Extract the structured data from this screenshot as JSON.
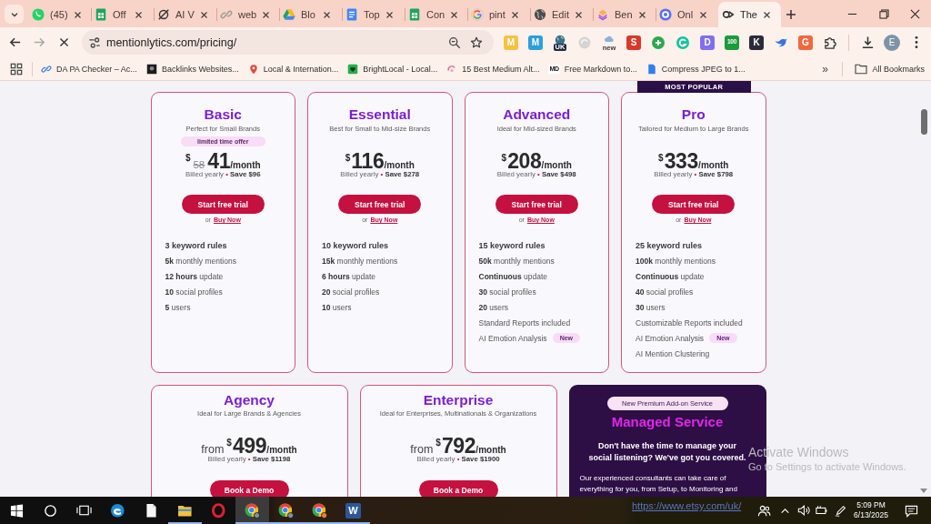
{
  "tabs": [
    {
      "title": "(45)",
      "selected": false
    },
    {
      "title": "Off",
      "selected": false
    },
    {
      "title": "AI V",
      "selected": false
    },
    {
      "title": "web",
      "selected": false
    },
    {
      "title": "Blo",
      "selected": false
    },
    {
      "title": "Top",
      "selected": false
    },
    {
      "title": "Con",
      "selected": false
    },
    {
      "title": "pint",
      "selected": false
    },
    {
      "title": "Edit",
      "selected": false
    },
    {
      "title": "Ben",
      "selected": false
    },
    {
      "title": "Onl",
      "selected": false
    },
    {
      "title": "The",
      "selected": true
    }
  ],
  "toolbar": {
    "url": "mentionlytics.com/pricing/",
    "profile_initial": "E"
  },
  "extensions": [
    {
      "kind": "letter",
      "glyph": "M",
      "color": "#f5c242"
    },
    {
      "kind": "letter",
      "glyph": "M",
      "color": "#2d9fd9"
    },
    {
      "kind": "badge",
      "glyph": "UK"
    },
    {
      "kind": "icon"
    },
    {
      "kind": "badge",
      "glyph": "new"
    },
    {
      "kind": "letter",
      "glyph": "S",
      "color": "#d8392b"
    },
    {
      "kind": "icon"
    },
    {
      "kind": "icon"
    },
    {
      "kind": "letter",
      "glyph": "D",
      "color": "#7f70f2"
    },
    {
      "kind": "letter",
      "glyph": "100",
      "color": "#1d9a3b"
    },
    {
      "kind": "letter",
      "glyph": "K",
      "color": "#2b2b38"
    },
    {
      "kind": "icon"
    },
    {
      "kind": "letter",
      "glyph": "G",
      "color": "#f0683c"
    }
  ],
  "bookmarks": {
    "items": [
      {
        "title": "DA PA Checker – Ac..."
      },
      {
        "title": "Backlinks Websites..."
      },
      {
        "title": "Local & Internation..."
      },
      {
        "title": "BrightLocal - Local..."
      },
      {
        "title": "15 Best Medium Alt..."
      },
      {
        "title": "Free Markdown to...",
        "icon_text": "MD"
      },
      {
        "title": "Compress JPEG to 1..."
      }
    ],
    "overflow": "»",
    "all_bookmarks": "All Bookmarks"
  },
  "plans": [
    {
      "name": "Basic",
      "tagline": "Perfect for Small Brands",
      "offer": "limited time offer",
      "currency": "$",
      "old_amount": "58",
      "amount": "41",
      "period": "/month",
      "billing": "Billed yearly",
      "separator": "•",
      "savings": "Save $96",
      "button": "Start free trial",
      "alt_prefix": "or",
      "alt_link": "Buy Now",
      "features": [
        {
          "kind": "headline",
          "text": "3 keyword rules"
        },
        {
          "kind": "detail",
          "text": "**5k** monthly mentions"
        },
        {
          "kind": "detail",
          "text": "**12 hours** update"
        },
        {
          "kind": "detail",
          "text": "**10** social profiles"
        },
        {
          "kind": "detail",
          "text": "**5** users"
        }
      ]
    },
    {
      "name": "Essential",
      "tagline": "Best for Small to Mid-size Brands",
      "currency": "$",
      "amount": "116",
      "period": "/month",
      "billing": "Billed yearly",
      "separator": "•",
      "savings": "Save $278",
      "button": "Start free trial",
      "alt_prefix": "or",
      "alt_link": "Buy Now",
      "features": [
        {
          "kind": "headline",
          "text": "10 keyword rules"
        },
        {
          "kind": "detail",
          "text": "**15k** monthly mentions"
        },
        {
          "kind": "detail",
          "text": "**6 hours** update"
        },
        {
          "kind": "detail",
          "text": "**20** social profiles"
        },
        {
          "kind": "detail",
          "text": "**10** users"
        }
      ]
    },
    {
      "name": "Advanced",
      "tagline": "Ideal for Mid-sized Brands",
      "currency": "$",
      "amount": "208",
      "period": "/month",
      "billing": "Billed yearly",
      "separator": "•",
      "savings": "Save $498",
      "button": "Start free trial",
      "alt_prefix": "or",
      "alt_link": "Buy Now",
      "features": [
        {
          "kind": "headline",
          "text": "15 keyword rules"
        },
        {
          "kind": "detail",
          "text": "**50k** monthly mentions"
        },
        {
          "kind": "detail",
          "text": "**Continuous** update"
        },
        {
          "kind": "detail",
          "text": "**30** social profiles"
        },
        {
          "kind": "detail",
          "text": "**20** users"
        },
        {
          "kind": "detail",
          "text": "Standard Reports included"
        },
        {
          "kind": "detail",
          "text": "AI Emotion Analysis",
          "badge": "New"
        }
      ]
    },
    {
      "name": "Pro",
      "ribbon": "MOST POPULAR",
      "tagline": "Tailored for Medium to Large Brands",
      "currency": "$",
      "amount": "333",
      "period": "/month",
      "billing": "Billed yearly",
      "separator": "•",
      "savings": "Save $798",
      "button": "Start free trial",
      "alt_prefix": "or",
      "alt_link": "Buy Now",
      "features": [
        {
          "kind": "headline",
          "text": "25 keyword rules"
        },
        {
          "kind": "detail",
          "text": "**100k** monthly mentions"
        },
        {
          "kind": "detail",
          "text": "**Continuous** update"
        },
        {
          "kind": "detail",
          "text": "**40** social profiles"
        },
        {
          "kind": "detail",
          "text": "**30** users"
        },
        {
          "kind": "detail",
          "text": "Customizable Reports included"
        },
        {
          "kind": "detail",
          "text": "AI Emotion Analysis",
          "badge": "New"
        },
        {
          "kind": "detail",
          "text": "AI Mention Clustering"
        }
      ]
    }
  ],
  "more_cards": [
    {
      "kind": "plan",
      "name": "Agency",
      "tagline": "Ideal for Large Brands & Agencies",
      "price_prefix": "from",
      "currency": "$",
      "amount": "499",
      "period": "/month",
      "billing": "Billed yearly",
      "separator": "•",
      "savings": "Save $1198",
      "button": "Book a Demo"
    },
    {
      "kind": "plan",
      "name": "Enterprise",
      "tagline": "Ideal for Enterprises, Multinationals & Organizations",
      "price_prefix": "from",
      "currency": "$",
      "amount": "792",
      "period": "/month",
      "billing": "Billed yearly",
      "separator": "•",
      "savings": "Save $1900",
      "button": "Book a Demo"
    },
    {
      "kind": "service",
      "pill": "New Premium Add-on Service",
      "name": "Managed Service",
      "pitch": "Don't have the time to manage your social listening? We've got you covered.",
      "body": "Our experienced consultants can take care of everything for you, from Setup, to Monitoring and"
    }
  ],
  "taskbar": {
    "apps": [
      {
        "running": false,
        "selected": false
      },
      {
        "running": false,
        "selected": false
      },
      {
        "running": true,
        "selected": false
      },
      {
        "running": false,
        "selected": false
      },
      {
        "running": true,
        "selected": true
      },
      {
        "running": true,
        "selected": false
      },
      {
        "running": true,
        "selected": false
      },
      {
        "running": true,
        "selected": false,
        "glyph": "W"
      }
    ],
    "time": "5:09 PM",
    "date": "6/13/2025"
  },
  "overlay_link": "https://www.etsy.com/uk/",
  "activation_notice": {
    "title": "Activate Windows",
    "detail": "Go to Settings to activate Windows."
  }
}
